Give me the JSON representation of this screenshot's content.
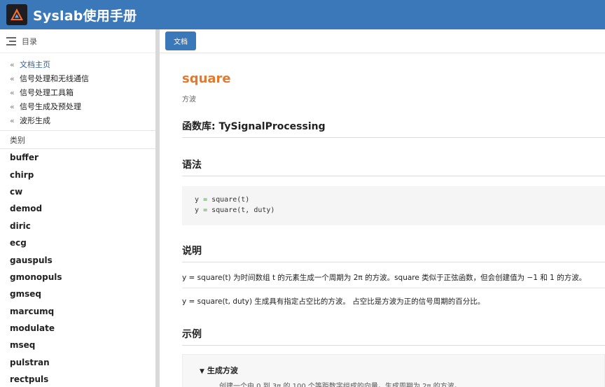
{
  "header": {
    "app_title": "Syslab使用手册"
  },
  "sidebar": {
    "toc_title": "目录",
    "breadcrumbs": [
      {
        "label": "文档主页"
      },
      {
        "label": "信号处理和无线通信"
      },
      {
        "label": "信号处理工具箱"
      },
      {
        "label": "信号生成及预处理"
      },
      {
        "label": "波形生成"
      }
    ],
    "category_label": "类别",
    "functions": [
      "buffer",
      "chirp",
      "cw",
      "demod",
      "diric",
      "ecg",
      "gauspuls",
      "gmonopuls",
      "gmseq",
      "marcumq",
      "modulate",
      "mseq",
      "pulstran",
      "rectpuls"
    ]
  },
  "toolbar": {
    "doc_button": "文档"
  },
  "doc": {
    "func_name": "square",
    "func_desc": "方波",
    "library_heading": "函数库: TySignalProcessing",
    "syntax_heading": "语法",
    "syntax_lines": [
      {
        "lhs": "y",
        "op": "=",
        "rhs": "square(t)"
      },
      {
        "lhs": "y",
        "op": "=",
        "rhs": "square(t, duty)"
      }
    ],
    "description_heading": "说明",
    "description_paragraphs": [
      "y = square(t) 为时间数组 t 的元素生成一个周期为 2π 的方波。square 类似于正弦函数，但会创建值为 −1 和 1 的方波。",
      "y = square(t, duty) 生成具有指定占空比的方波。 占空比是方波为正的信号周期的百分比。"
    ],
    "examples_heading": "示例",
    "example_summary": "生成方波",
    "example_cutoff_text": "创建一个由 0 到 3π 的 100 个等距数字组成的向量。生成周期为 2π 的方波。"
  },
  "colors": {
    "brand": "#3b78ba",
    "func_name": "#e07a2f"
  }
}
